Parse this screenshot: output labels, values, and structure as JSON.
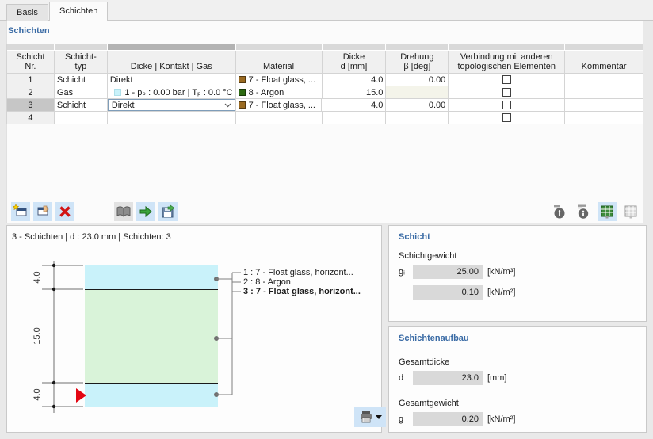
{
  "tabs": {
    "basis": "Basis",
    "schichten": "Schichten"
  },
  "section": {
    "title": "Schichten"
  },
  "table": {
    "headers": {
      "nr1": "Schicht",
      "nr2": "Nr.",
      "typ1": "Schicht-",
      "typ2": "typ",
      "dkg": "Dicke | Kontakt | Gas",
      "material": "Material",
      "dicke1": "Dicke",
      "dicke2": "d [mm]",
      "drehung1": "Drehung",
      "drehung2": "β [deg]",
      "verb1": "Verbindung mit anderen",
      "verb2": "topologischen Elementen",
      "kommentar": "Kommentar"
    },
    "rows": [
      {
        "nr": "1",
        "typ": "Schicht",
        "dkg": "Direkt",
        "material": "7 - Float glass, ...",
        "material_color": "#9a6a21",
        "dicke": "4.0",
        "drehung": "0.00",
        "kommentar": ""
      },
      {
        "nr": "2",
        "typ": "Gas",
        "dkg": "1 - pₚ : 0.00 bar | Tₚ : 0.0 °C",
        "dkg_swatch": "#c9f2fa",
        "material": "8 - Argon",
        "material_color": "#2d6a12",
        "dicke": "15.0",
        "drehung": "",
        "kommentar": ""
      },
      {
        "nr": "3",
        "typ": "Schicht",
        "dkg": "Direkt",
        "material": "7 - Float glass, ...",
        "material_color": "#9a6a21",
        "dicke": "4.0",
        "drehung": "0.00",
        "kommentar": ""
      },
      {
        "nr": "4",
        "typ": "",
        "dkg": "",
        "material": "",
        "dicke": "",
        "drehung": "",
        "kommentar": ""
      }
    ]
  },
  "toolbar": {
    "icons": [
      "new-row",
      "insert-row",
      "delete-row",
      "library",
      "import-from-library",
      "save-to-library",
      "layer-info",
      "structure-info",
      "export-table",
      "export-all-tables"
    ]
  },
  "preview": {
    "status": "3 - Schichten | d : 23.0 mm | Schichten: 3",
    "dims": [
      "4.0",
      "15.0",
      "4.0"
    ],
    "layers": [
      {
        "color": "#c9f2fa"
      },
      {
        "color": "#d9f3d9"
      },
      {
        "color": "#c9f2fa"
      }
    ],
    "legend": [
      {
        "label": "1 : 7 - Float glass, horizont..."
      },
      {
        "label": "2 : 8 - Argon"
      },
      {
        "label": "3 : 7 - Float glass, horizont..."
      }
    ]
  },
  "schicht_panel": {
    "title": "Schicht",
    "group": "Schichtgewicht",
    "symbol": "gᵢ",
    "value1": "25.00",
    "unit1": "[kN/m³]",
    "value2": "0.10",
    "unit2": "[kN/m²]"
  },
  "aufbau_panel": {
    "title": "Schichtenaufbau",
    "group1": "Gesamtdicke",
    "symbol1": "d",
    "value1": "23.0",
    "unit1": "[mm]",
    "group2": "Gesamtgewicht",
    "symbol2": "g",
    "value2": "0.20",
    "unit2": "[kN/m²]"
  },
  "colors": {
    "accent_blue": "#3a6ba5",
    "toolbar_button_bg": "#cfe4f7",
    "selected_row_grey": "#c6c6c6",
    "layer_cyan": "#c9f2fa",
    "layer_green": "#d9f3d9",
    "material_brown": "#9a6a21",
    "material_argon_green": "#2d6a12",
    "delete_red": "#d21414",
    "selection_arrow_red": "#e30613",
    "disabled_cell": "#f4f4ea"
  }
}
